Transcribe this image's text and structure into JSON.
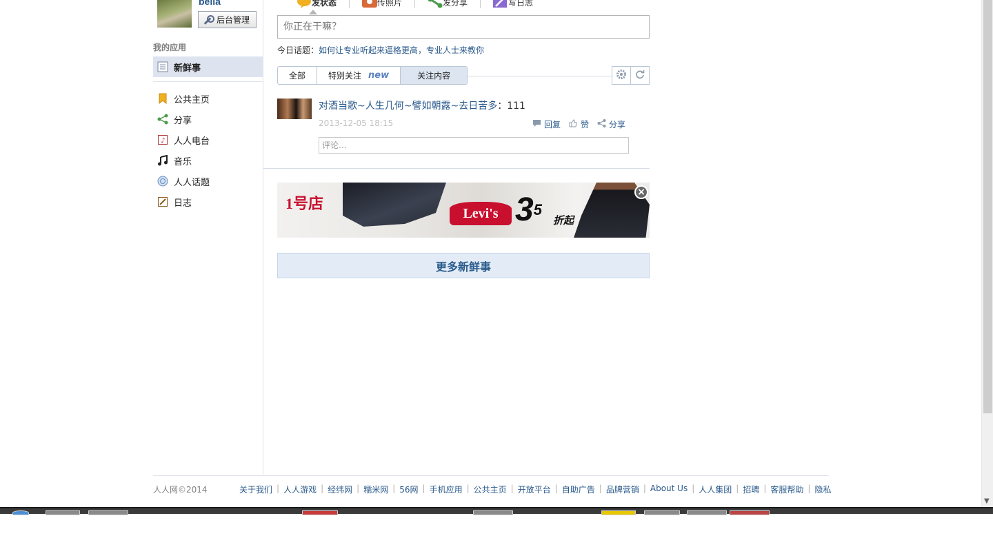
{
  "user": {
    "name": "bella",
    "admin_label": "后台管理"
  },
  "sidebar": {
    "apps_title": "我的应用",
    "items": [
      {
        "label": "新鲜事",
        "icon": "list-icon"
      },
      {
        "label": "公共主页",
        "icon": "bookmark-icon"
      },
      {
        "label": "分享",
        "icon": "share-icon"
      },
      {
        "label": "人人电台",
        "icon": "radio-icon"
      },
      {
        "label": "音乐",
        "icon": "music-icon"
      },
      {
        "label": "人人话题",
        "icon": "topic-icon"
      },
      {
        "label": "日志",
        "icon": "blog-icon"
      }
    ]
  },
  "publisher": {
    "tabs": [
      {
        "label": "发状态",
        "icon": "status-icon"
      },
      {
        "label": "传照片",
        "icon": "photo-icon"
      },
      {
        "label": "发分享",
        "icon": "share-icon"
      },
      {
        "label": "写日志",
        "icon": "blog-icon"
      }
    ],
    "placeholder": "你正在干嘛？",
    "topic_prefix": "今日话题：",
    "topic_link": "如何让专业听起来逼格更高，专业人士来教你"
  },
  "filter": {
    "tabs": [
      "全部",
      "特别关注",
      "关注内容"
    ],
    "new_badge": "new"
  },
  "feed": {
    "text_link": "对酒当歌~人生几何~譬如朝露~去日苦多",
    "text_suffix": "：111",
    "time": "2013-12-05 18:15",
    "actions": {
      "reply": "回复",
      "like": "赞",
      "share": "分享"
    },
    "comment_placeholder": "评论..."
  },
  "ad": {
    "brand": "1号店",
    "brand2": "Levi's",
    "discount": "3",
    "discount_sup": "5",
    "discount_suffix": "折起"
  },
  "more_label": "更多新鲜事",
  "footer": {
    "copyright": "人人网©2014",
    "links": [
      "关于我们",
      "人人游戏",
      "经纬网",
      "糯米网",
      "56网",
      "手机应用",
      "公共主页",
      "开放平台",
      "自助广告",
      "品牌营销",
      "About Us",
      "人人集团",
      "招聘",
      "客服帮助",
      "隐私"
    ]
  }
}
